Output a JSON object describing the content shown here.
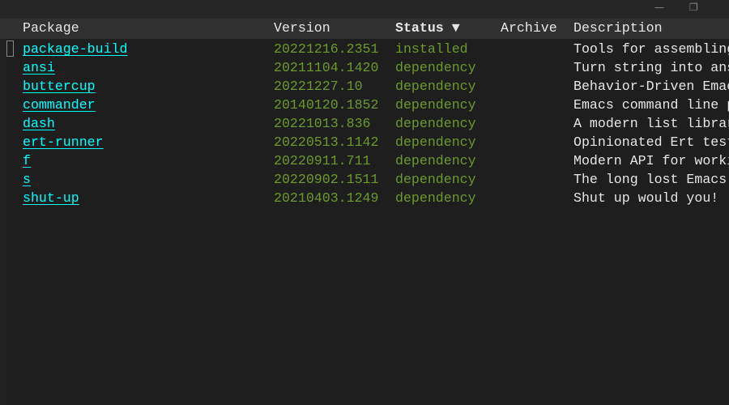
{
  "window": {
    "minimize_icon": "minimize-icon",
    "restore_icon": "restore-icon"
  },
  "header": {
    "package": "Package",
    "version": "Version",
    "status": "Status ▼",
    "archive": "Archive",
    "description": "Description"
  },
  "packages": [
    {
      "name": "package-build",
      "version": "20221216.2351",
      "status": "installed",
      "archive": "",
      "description": "Tools for assembling"
    },
    {
      "name": "ansi",
      "version": "20211104.1420",
      "status": "dependency",
      "archive": "",
      "description": "Turn string into ans"
    },
    {
      "name": "buttercup",
      "version": "20221227.10",
      "status": "dependency",
      "archive": "",
      "description": "Behavior-Driven Emac"
    },
    {
      "name": "commander",
      "version": "20140120.1852",
      "status": "dependency",
      "archive": "",
      "description": "Emacs command line p"
    },
    {
      "name": "dash",
      "version": "20221013.836",
      "status": "dependency",
      "archive": "",
      "description": "A modern list librar"
    },
    {
      "name": "ert-runner",
      "version": "20220513.1142",
      "status": "dependency",
      "archive": "",
      "description": "Opinionated Ert test"
    },
    {
      "name": "f",
      "version": "20220911.711",
      "status": "dependency",
      "archive": "",
      "description": "Modern API for worki"
    },
    {
      "name": "s",
      "version": "20220902.1511",
      "status": "dependency",
      "archive": "",
      "description": "The long lost Emacs "
    },
    {
      "name": "shut-up",
      "version": "20210403.1249",
      "status": "dependency",
      "archive": "",
      "description": "Shut up would you!"
    }
  ],
  "colors": {
    "link": "#00ffff",
    "status": "#6b9a2c",
    "text": "#e6e6e6",
    "background": "#1e1e1e"
  }
}
